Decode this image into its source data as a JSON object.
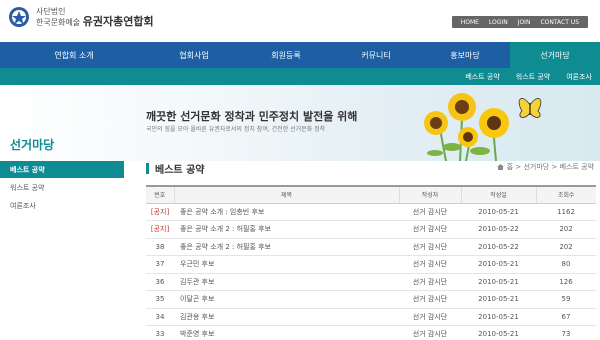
{
  "header": {
    "logo_sub": "사단법인",
    "logo_org_prefix": "한국문화예술",
    "logo_org_name": "유권자총연합회",
    "top_links": [
      "HOME",
      "LOGIN",
      "JOIN",
      "CONTACT US"
    ]
  },
  "gnb": [
    {
      "label": "연합회 소개",
      "active": false
    },
    {
      "label": "협회사업",
      "active": false
    },
    {
      "label": "회원등록",
      "active": false
    },
    {
      "label": "커뮤니티",
      "active": false
    },
    {
      "label": "홍보마당",
      "active": false
    },
    {
      "label": "선거마당",
      "active": true
    }
  ],
  "subnav": [
    "베스트 공약",
    "워스트 공약",
    "여론조사"
  ],
  "banner": {
    "title": "깨끗한 선거문화 정착과 민주정치 발전을 위해",
    "subtitle": "국민의 힘을 모아 올바른 유권자로서의 정치 참여, 건전한 선거문화 정착"
  },
  "lnb": {
    "title": "선거마당",
    "items": [
      {
        "label": "베스트 공약",
        "active": true
      },
      {
        "label": "워스트 공약",
        "active": false
      },
      {
        "label": "여론조사",
        "active": false
      }
    ]
  },
  "content": {
    "title": "베스트 공약",
    "breadcrumb": "홈 > 선거마당 > 베스트 공약"
  },
  "table": {
    "columns": [
      "번호",
      "제목",
      "작성자",
      "작성일",
      "조회수"
    ],
    "rows": [
      {
        "num": "[공지]",
        "notice": true,
        "subject": "좋은 공약 소개 : 임충빈 후보",
        "writer": "선거 감시단",
        "date": "2010-05-21",
        "hits": "1162"
      },
      {
        "num": "[공지]",
        "notice": true,
        "subject": "좋은 공약 소개 2 : 허필홍 후보",
        "writer": "선거 감시단",
        "date": "2010-05-22",
        "hits": "202"
      },
      {
        "num": "38",
        "notice": false,
        "subject": "좋은 공약 소개 2 : 허필홍 후보",
        "writer": "선거 감시단",
        "date": "2010-05-22",
        "hits": "202"
      },
      {
        "num": "37",
        "notice": false,
        "subject": "우근민 후보",
        "writer": "선거 감시단",
        "date": "2010-05-21",
        "hits": "80"
      },
      {
        "num": "36",
        "notice": false,
        "subject": "김두관 후보",
        "writer": "선거 감시단",
        "date": "2010-05-21",
        "hits": "126"
      },
      {
        "num": "35",
        "notice": false,
        "subject": "이달곤 후보",
        "writer": "선거 감시단",
        "date": "2010-05-21",
        "hits": "59"
      },
      {
        "num": "34",
        "notice": false,
        "subject": "김관용 후보",
        "writer": "선거 감시단",
        "date": "2010-05-21",
        "hits": "67"
      },
      {
        "num": "33",
        "notice": false,
        "subject": "박준영 후보",
        "writer": "선거 감시단",
        "date": "2010-05-21",
        "hits": "73"
      }
    ]
  },
  "colors": {
    "nav_blue": "#1e5fa3",
    "accent_teal": "#0f8b92",
    "notice_red": "#c0392b"
  }
}
